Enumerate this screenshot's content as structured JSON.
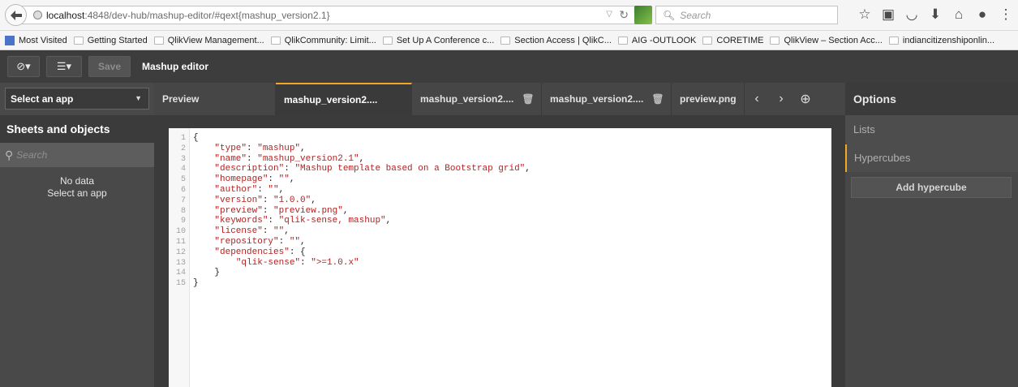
{
  "browser": {
    "url_host": "localhost",
    "url_path": ":4848/dev-hub/mashup-editor/#qext{mashup_version2.1}",
    "search_placeholder": "Search",
    "bookmarks": [
      {
        "label": "Most Visited",
        "icon": "most-visited-icon"
      },
      {
        "label": "Getting Started",
        "icon": "folder-icon"
      },
      {
        "label": "QlikView Management...",
        "icon": "folder-icon"
      },
      {
        "label": "QlikCommunity: Limit...",
        "icon": "folder-icon"
      },
      {
        "label": "Set Up A Conference c...",
        "icon": "folder-icon"
      },
      {
        "label": "Section Access | QlikC...",
        "icon": "folder-icon"
      },
      {
        "label": "AIG -OUTLOOK",
        "icon": "folder-icon"
      },
      {
        "label": "CORETIME",
        "icon": "folder-icon"
      },
      {
        "label": "QlikView – Section Acc...",
        "icon": "folder-icon"
      },
      {
        "label": "indiancitizenshiponlin...",
        "icon": "folder-icon"
      }
    ],
    "toolbar_icons": [
      "star-icon",
      "reading-list-icon",
      "pocket-icon",
      "download-icon",
      "home-icon",
      "chat-icon",
      "menu-icon"
    ]
  },
  "toolbar": {
    "save_label": "Save",
    "title": "Mashup editor"
  },
  "left": {
    "select_app": "Select an app",
    "heading": "Sheets and objects",
    "search_placeholder": "Search",
    "no_data_line1": "No data",
    "no_data_line2": "Select an app"
  },
  "tabs": [
    {
      "label": "Preview",
      "active": false,
      "trash": false
    },
    {
      "label": "mashup_version2....",
      "active": true,
      "trash": false
    },
    {
      "label": "mashup_version2....",
      "active": false,
      "trash": true
    },
    {
      "label": "mashup_version2....",
      "active": false,
      "trash": true
    },
    {
      "label": "preview.png",
      "active": false,
      "trash": false
    }
  ],
  "editor": {
    "lines": [
      "{",
      "    \"type\": \"mashup\",",
      "    \"name\": \"mashup_version2.1\",",
      "    \"description\": \"Mashup template based on a Bootstrap grid\",",
      "    \"homepage\": \"\",",
      "    \"author\": \"\",",
      "    \"version\": \"1.0.0\",",
      "    \"preview\": \"preview.png\",",
      "    \"keywords\": \"qlik-sense, mashup\",",
      "    \"license\": \"\",",
      "    \"repository\": \"\",",
      "    \"dependencies\": {",
      "        \"qlik-sense\": \">=1.0.x\"",
      "    }",
      "}"
    ]
  },
  "right": {
    "heading": "Options",
    "lists": "Lists",
    "hypercubes": "Hypercubes",
    "add_hypercube": "Add hypercube"
  },
  "colors": {
    "accent": "#f5a623",
    "string": "#b22222"
  }
}
